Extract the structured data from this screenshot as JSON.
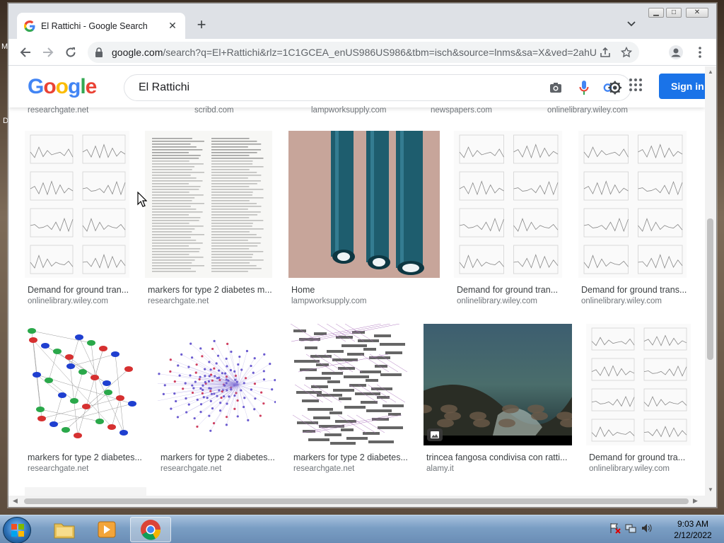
{
  "browser": {
    "tab_title": "El Rattichi - Google Search",
    "url_host": "google.com",
    "url_rest": "/search?q=El+Rattichi&rlz=1C1GCEA_enUS986US986&tbm=isch&source=lnms&sa=X&ved=2ahUKE...",
    "icons": [
      "back-icon",
      "forward-icon",
      "reload-icon",
      "lock-icon",
      "share-icon",
      "star-icon",
      "profile-icon",
      "menu-icon"
    ]
  },
  "google": {
    "query": "El Rattichi",
    "signin_label": "Sign in",
    "logo_letters": [
      "G",
      "o",
      "o",
      "g",
      "l",
      "e"
    ],
    "logo_colors": [
      "#4285F4",
      "#EA4335",
      "#FBBC05",
      "#4285F4",
      "#34A853",
      "#EA4335"
    ]
  },
  "top_sources": [
    "researchgate.net",
    "scribd.com",
    "lampworksupply.com",
    "newspapers.com",
    "onlinelibrary.wiley.com"
  ],
  "row1": [
    {
      "caption": "Demand for ground tran...",
      "source": "onlinelibrary.wiley.com",
      "kind": "charts"
    },
    {
      "caption": "markers for type 2 diabetes m...",
      "source": "researchgate.net",
      "kind": "paper"
    },
    {
      "caption": "Home",
      "source": "lampworksupply.com",
      "kind": "tubes"
    },
    {
      "caption": "Demand for ground tran...",
      "source": "onlinelibrary.wiley.com",
      "kind": "charts"
    },
    {
      "caption": "Demand for ground trans...",
      "source": "onlinelibrary.wiley.com",
      "kind": "charts"
    }
  ],
  "row2": [
    {
      "caption": "markers for type 2 diabetes...",
      "source": "researchgate.net",
      "kind": "network"
    },
    {
      "caption": "markers for type 2 diabetes...",
      "source": "researchgate.net",
      "kind": "network2"
    },
    {
      "caption": "markers for type 2 diabetes...",
      "source": "researchgate.net",
      "kind": "words"
    },
    {
      "caption": "trincea fangosa condivisa con ratti...",
      "source": "alamy.it",
      "kind": "painting"
    },
    {
      "caption": "Demand for ground tra...",
      "source": "onlinelibrary.wiley.com",
      "kind": "charts"
    }
  ],
  "taskbar": {
    "time": "9:03 AM",
    "date": "2/12/2022"
  }
}
